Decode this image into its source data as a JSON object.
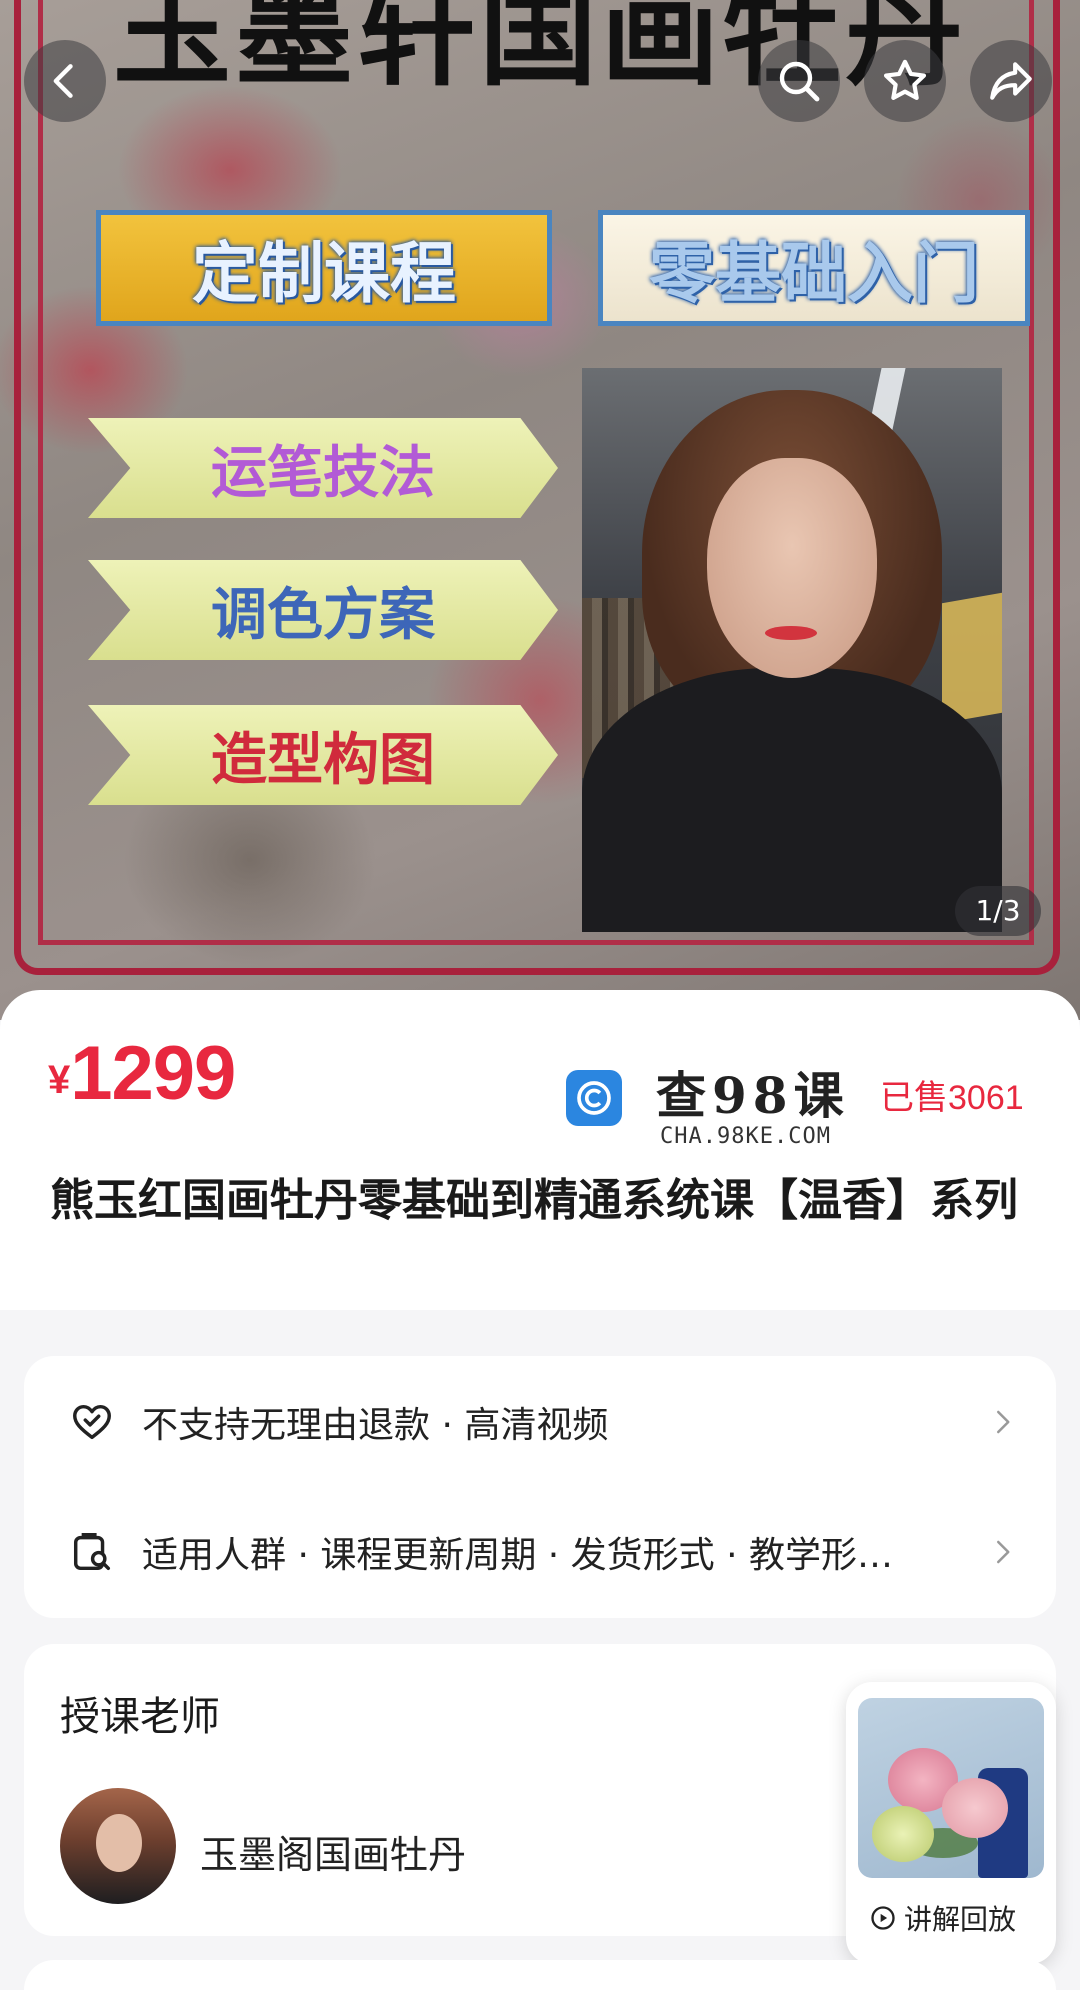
{
  "hero": {
    "heading": "玉墨轩国画牡丹",
    "tag_custom": "定制课程",
    "tag_beginner": "零基础入门",
    "skill_1": "运笔技法",
    "skill_2": "调色方案",
    "skill_3": "造型构图",
    "page_indicator": "1/3"
  },
  "nav": {
    "back_icon": "chevron-left-icon",
    "search_icon": "search-icon",
    "favorite_icon": "star-icon",
    "share_icon": "share-icon"
  },
  "product": {
    "currency": "¥",
    "price": "1299",
    "watermark_text": "查98课",
    "watermark_sub": "CHA.98KE.COM",
    "sold": "已售3061",
    "title": "熊玉红国画牡丹零基础到精通系统课【温香】系列"
  },
  "service": {
    "row1": "不支持无理由退款 · 高清视频",
    "row2": "适用人群 · 课程更新周期 · 发货形式 · 教学形…"
  },
  "teacher": {
    "heading": "授课老师",
    "name": "玉墨阁国画牡丹"
  },
  "replay": {
    "label": "讲解回放"
  },
  "colors": {
    "price_red": "#e8283f",
    "frame_red": "#a8213c",
    "card_bg": "#ffffff",
    "page_bg": "#f5f5f7"
  }
}
